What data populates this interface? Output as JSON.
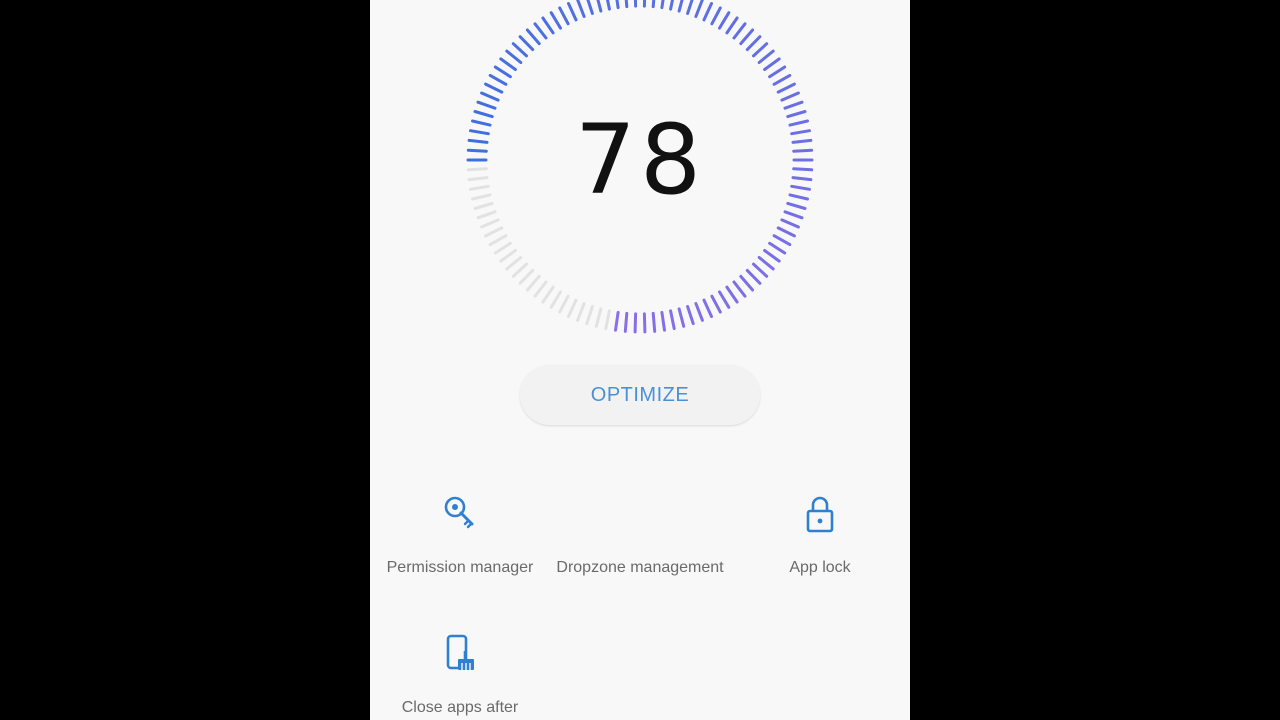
{
  "device_score": {
    "value": "78",
    "fraction": 0.78,
    "colors": {
      "active_start": "#3e6fe0",
      "active_end": "#8a6fe6",
      "inactive": "#e2e2e2"
    }
  },
  "optimize_button": {
    "label": "OPTIMIZE",
    "color": "#4a90d9"
  },
  "tools": [
    {
      "label": "Permission manager",
      "icon": "key-search-icon"
    },
    {
      "label": "Dropzone management",
      "icon": ""
    },
    {
      "label": "App lock",
      "icon": "padlock-icon"
    },
    {
      "label": "Close apps after",
      "icon": "phone-broom-icon"
    }
  ],
  "accent_color": "#2f80d1"
}
